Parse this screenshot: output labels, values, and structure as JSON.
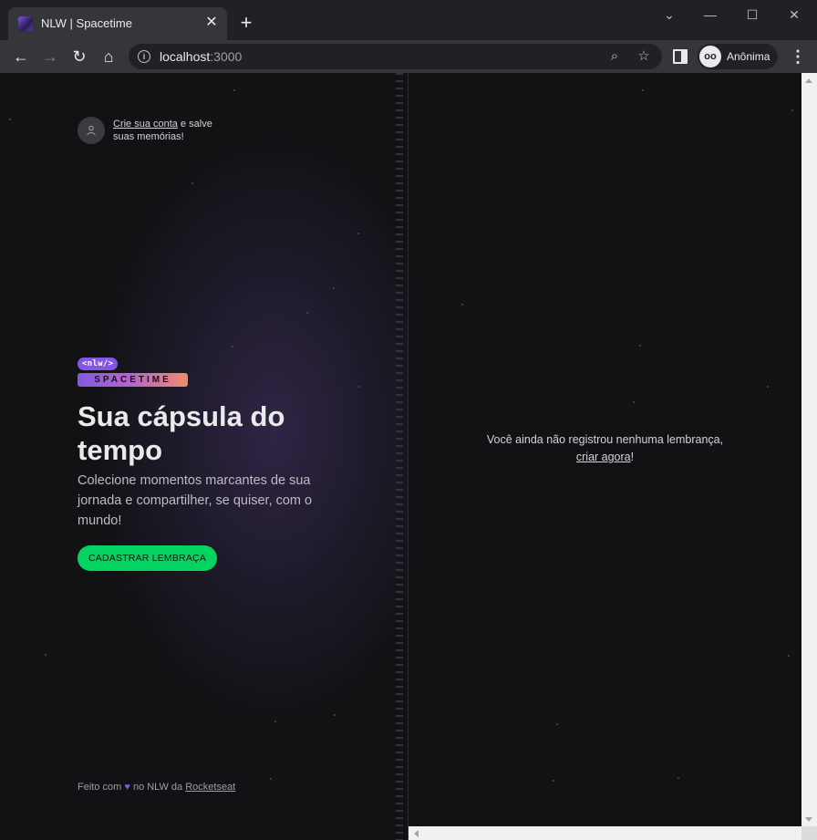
{
  "browser": {
    "tab_title": "NLW | Spacetime",
    "tab_close": "✕",
    "new_tab": "+",
    "url_host": "localhost",
    "url_port": ":3000",
    "profile_label": "Anônima"
  },
  "signin": {
    "link_text": "Crie sua conta",
    "rest_text": " e salve suas memórias!"
  },
  "logo": {
    "badge": "<nlw/>",
    "wordmark": "SPACETIME"
  },
  "hero": {
    "title": "Sua cápsula do tempo",
    "text": "Colecione momentos marcantes de sua jornada e compartilher, se quiser, com o mundo!",
    "cta_label": "CADASTRAR LEMBRAÇA"
  },
  "footer": {
    "prefix": "Feito com",
    "heart": "♥",
    "middle": " no NLW da ",
    "link": "Rocketseat"
  },
  "empty_state": {
    "text": "Você ainda não registrou nenhuma lembrança,",
    "link": "criar agora",
    "suffix": "!"
  },
  "colors": {
    "accent_purple": "#8257e5",
    "cta_green": "#04d361",
    "background": "#121215"
  }
}
